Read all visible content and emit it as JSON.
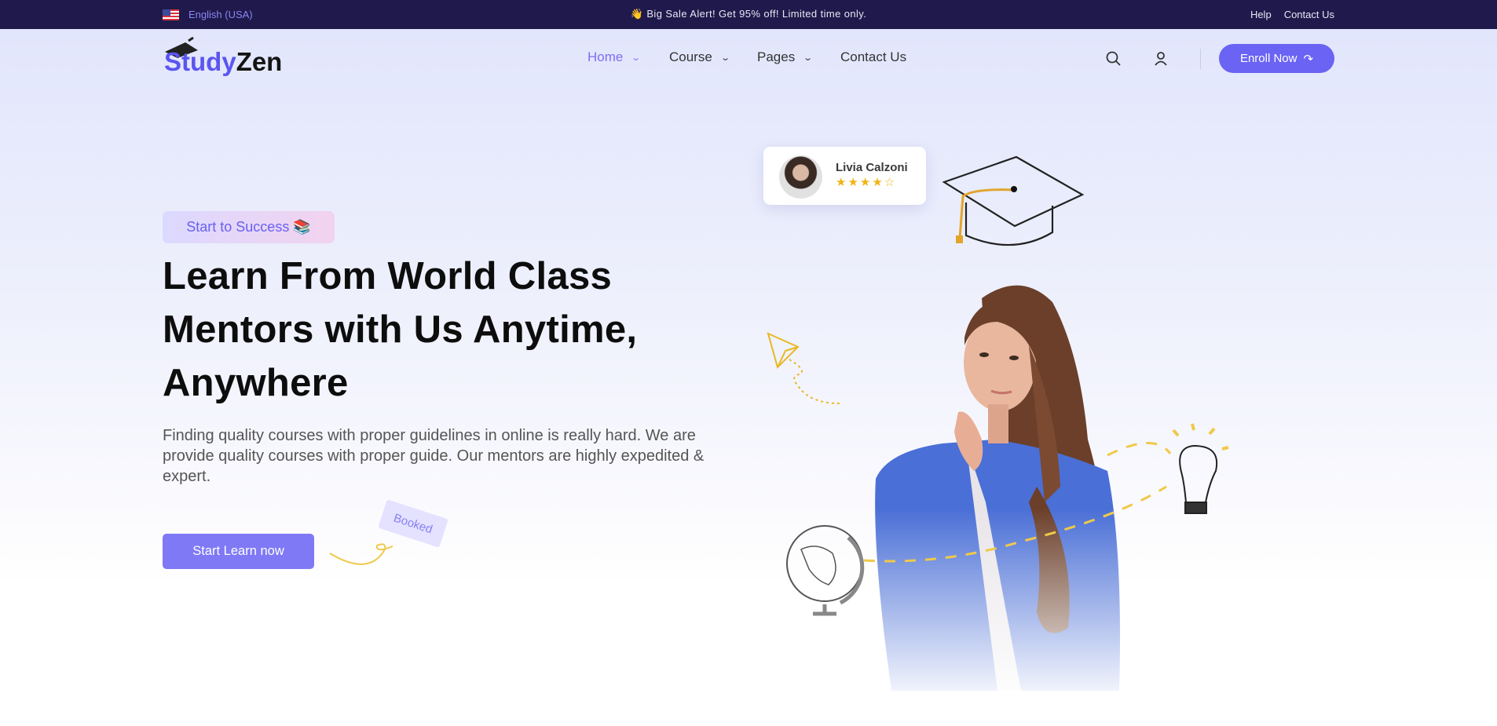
{
  "topbar": {
    "language": "English (USA)",
    "sale_icon": "👋",
    "sale_text": "Big Sale Alert! Get 95% off! Limited time only.",
    "links": [
      "Help",
      "Contact Us"
    ]
  },
  "header": {
    "logo": {
      "part1": "Study",
      "part2": "Zen"
    },
    "nav": [
      {
        "label": "Home",
        "active": true,
        "dropdown": true
      },
      {
        "label": "Course",
        "dropdown": true
      },
      {
        "label": "Pages",
        "dropdown": true
      },
      {
        "label": "Contact Us",
        "dropdown": false
      }
    ],
    "enroll_label": "Enroll Now",
    "icons": [
      "search-icon",
      "user-icon",
      "arrow-icon"
    ]
  },
  "hero": {
    "badge": "Start to Success 📚",
    "headline": {
      "line1": "Learn From World ",
      "highlight": "Class",
      "line2": "Mentors with Us Anytime,",
      "line3": "Anywhere"
    },
    "description": "Finding quality courses with proper guidelines in online is really hard. We are provide quality courses with proper guide. Our mentors are highly expedited & expert.",
    "cta_label": "Start Learn now",
    "booked_tag": "Booked",
    "review": {
      "name": "Livia Calzoni",
      "rating": 4,
      "max": 5,
      "stars": "★★★★☆"
    }
  },
  "colors": {
    "primary": "#6a63f3",
    "topbar": "#1f1a4b",
    "accent": "#f6c744"
  }
}
